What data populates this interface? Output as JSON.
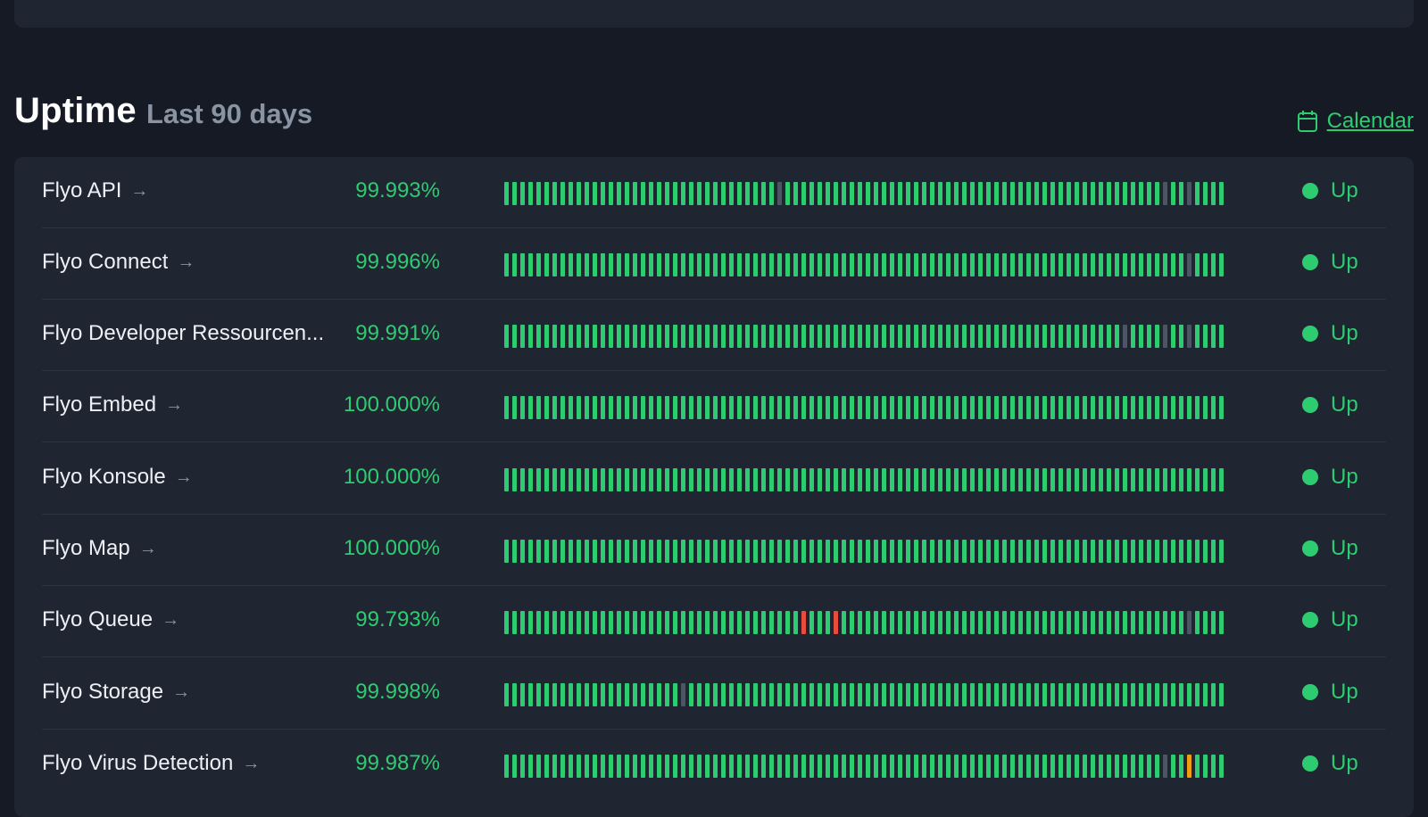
{
  "header": {
    "title": "Uptime",
    "subtitle": "Last 90 days",
    "calendar_label": "Calendar",
    "calendar_icon": "calendar-icon"
  },
  "colors": {
    "up": "#2ecc71",
    "degraded": "#4b5563",
    "outage": "#e74c3c",
    "partial": "#f39c12"
  },
  "days": 90,
  "services": [
    {
      "name": "Flyo API",
      "uptime": "99.993%",
      "status": "Up",
      "has_arrow": true,
      "gray_days": [
        34,
        82,
        85
      ],
      "red_days": [],
      "orange_days": []
    },
    {
      "name": "Flyo Connect",
      "uptime": "99.996%",
      "status": "Up",
      "has_arrow": true,
      "gray_days": [
        85
      ],
      "red_days": [],
      "orange_days": []
    },
    {
      "name": "Flyo Developer Ressourcen...",
      "uptime": "99.991%",
      "status": "Up",
      "has_arrow": false,
      "gray_days": [
        77,
        82,
        85
      ],
      "red_days": [],
      "orange_days": []
    },
    {
      "name": "Flyo Embed",
      "uptime": "100.000%",
      "status": "Up",
      "has_arrow": true,
      "gray_days": [],
      "red_days": [],
      "orange_days": []
    },
    {
      "name": "Flyo Konsole",
      "uptime": "100.000%",
      "status": "Up",
      "has_arrow": true,
      "gray_days": [],
      "red_days": [],
      "orange_days": []
    },
    {
      "name": "Flyo Map",
      "uptime": "100.000%",
      "status": "Up",
      "has_arrow": true,
      "gray_days": [],
      "red_days": [],
      "orange_days": []
    },
    {
      "name": "Flyo Queue",
      "uptime": "99.793%",
      "status": "Up",
      "has_arrow": true,
      "gray_days": [
        85
      ],
      "red_days": [
        37,
        41
      ],
      "orange_days": []
    },
    {
      "name": "Flyo Storage",
      "uptime": "99.998%",
      "status": "Up",
      "has_arrow": true,
      "gray_days": [
        22
      ],
      "red_days": [],
      "orange_days": []
    },
    {
      "name": "Flyo Virus Detection",
      "uptime": "99.987%",
      "status": "Up",
      "has_arrow": true,
      "gray_days": [
        82
      ],
      "red_days": [],
      "orange_days": [
        85
      ]
    }
  ]
}
